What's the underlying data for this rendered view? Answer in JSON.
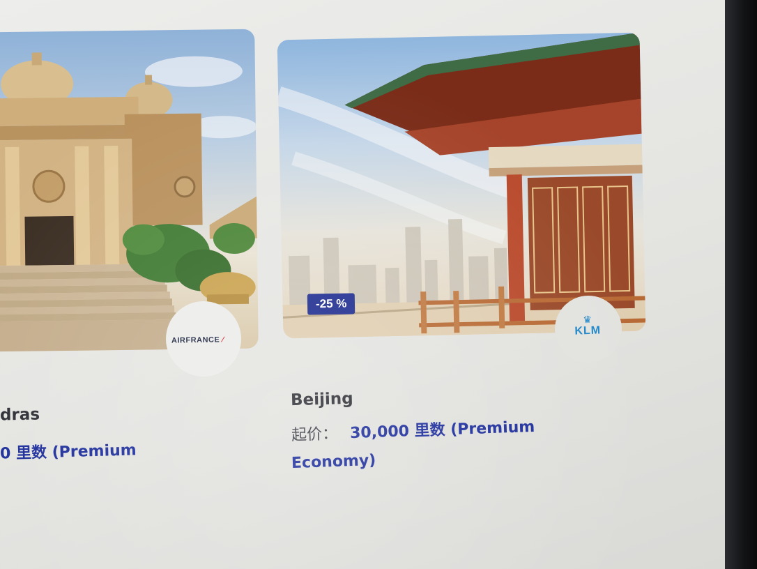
{
  "cards": [
    {
      "city": "Madras",
      "title": "dras",
      "airline_logo": "AIRFRANCE",
      "price": "0 里数 (Premium"
    },
    {
      "city": "Beijing",
      "title": "Beijing",
      "airline_logo": "KLM",
      "discount": "-25 %",
      "price_prefix": "起价：",
      "price_line1": "30,000 里数 (Premium",
      "price_line2": "Economy)"
    }
  ],
  "colors": {
    "price": "#1b2c9a",
    "badge": "#1d2b8f",
    "klm": "#1f86c7",
    "airfrance_red": "#d12030"
  }
}
